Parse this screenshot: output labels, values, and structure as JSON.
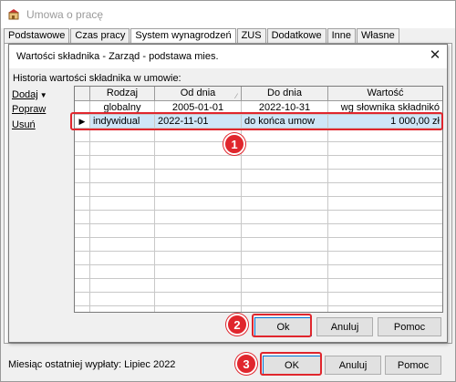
{
  "window": {
    "title": "Umowa o pracę",
    "tabs": [
      {
        "label": "Podstawowe"
      },
      {
        "label": "Czas pracy"
      },
      {
        "label": "System wynagrodzeń"
      },
      {
        "label": "ZUS"
      },
      {
        "label": "Dodatkowe"
      },
      {
        "label": "Inne"
      },
      {
        "label": "Własne"
      }
    ],
    "active_tab": "System wynagrodzeń",
    "status": "Miesiąc ostatniej wypłaty: Lipiec 2022",
    "buttons": {
      "ok": "OK",
      "cancel": "Anuluj",
      "help": "Pomoc"
    }
  },
  "dialog": {
    "title": "Wartości składnika - Zarząd - podstawa mies.",
    "history_label": "Historia wartości składnika w umowie:",
    "side_links": {
      "add": "Dodaj",
      "edit": "Popraw",
      "delete": "Usuń"
    },
    "columns": [
      "Rodzaj",
      "Od dnia",
      "Do dnia",
      "Wartość"
    ],
    "rows": [
      {
        "rodzaj": "globalny",
        "od": "2005-01-01",
        "do": "2022-10-31",
        "wartosc": "wg słownika składnikó",
        "selected": false
      },
      {
        "rodzaj": "indywidual",
        "od": "2022-11-01",
        "do": "do końca umow",
        "wartosc": "1 000,00 zł",
        "selected": true
      }
    ],
    "buttons": {
      "ok": "Ok",
      "cancel": "Anuluj",
      "help": "Pomoc"
    }
  },
  "annotations": [
    "1",
    "2",
    "3"
  ],
  "colors": {
    "highlight": "#e0262d",
    "selection": "#cfe6f7",
    "default_button_border": "#0078d7"
  }
}
